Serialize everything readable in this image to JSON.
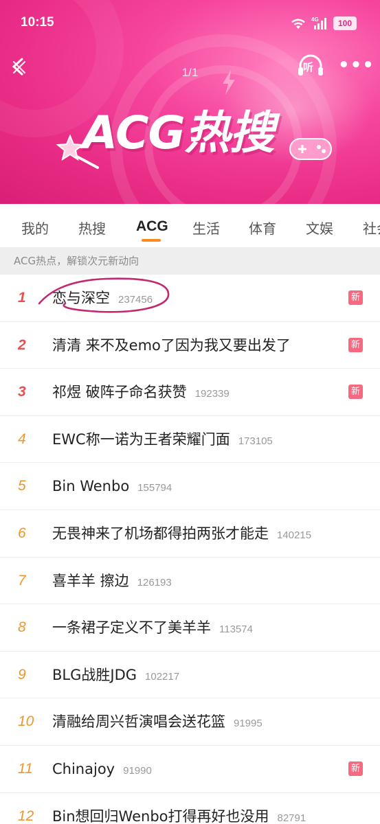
{
  "status": {
    "time": "10:15",
    "network": "4G",
    "battery": "100"
  },
  "header": {
    "page_indicator": "1/1",
    "listen_label": "听",
    "more_label": "•••",
    "title": "ACG热搜"
  },
  "tabs": [
    {
      "label": "我的",
      "active": false
    },
    {
      "label": "热搜",
      "active": false
    },
    {
      "label": "ACG",
      "active": true
    },
    {
      "label": "生活",
      "active": false
    },
    {
      "label": "体育",
      "active": false
    },
    {
      "label": "文娱",
      "active": false
    },
    {
      "label": "社会",
      "active": false
    }
  ],
  "subtitle": "ACG热点，解锁次元新动向",
  "list": [
    {
      "rank": "1",
      "topic": "恋与深空",
      "count": "237456",
      "badge": "新"
    },
    {
      "rank": "2",
      "topic": "清清 来不及emo了因为我又要出发了",
      "count": "",
      "badge": "新"
    },
    {
      "rank": "3",
      "topic": "祁煜 破阵子命名获赞",
      "count": "192339",
      "badge": "新"
    },
    {
      "rank": "4",
      "topic": "EWC称一诺为王者荣耀门面",
      "count": "173105",
      "badge": ""
    },
    {
      "rank": "5",
      "topic": "Bin Wenbo",
      "count": "155794",
      "badge": ""
    },
    {
      "rank": "6",
      "topic": "无畏神来了机场都得拍两张才能走",
      "count": "140215",
      "badge": ""
    },
    {
      "rank": "7",
      "topic": "喜羊羊 擦边",
      "count": "126193",
      "badge": ""
    },
    {
      "rank": "8",
      "topic": "一条裙子定义不了美羊羊",
      "count": "113574",
      "badge": ""
    },
    {
      "rank": "9",
      "topic": "BLG战胜JDG",
      "count": "102217",
      "badge": ""
    },
    {
      "rank": "10",
      "topic": "清融给周兴哲演唱会送花篮",
      "count": "91995",
      "badge": ""
    },
    {
      "rank": "11",
      "topic": "Chinajoy",
      "count": "91990",
      "badge": "新"
    },
    {
      "rank": "12",
      "topic": "Bin想回归Wenbo打得再好也没用",
      "count": "82791",
      "badge": ""
    }
  ],
  "colors": {
    "banner": "#e92c86",
    "accent_underline": "#ff8a1e",
    "rank_top": "#e94f4f",
    "rank_normal": "#f0952a",
    "badge": "#f56a81",
    "annotation": "#c2276f"
  },
  "icons": {
    "back": "back-icon",
    "listen": "headphones-icon",
    "more": "more-icon",
    "wifi": "wifi-icon",
    "signal": "signal-icon"
  }
}
